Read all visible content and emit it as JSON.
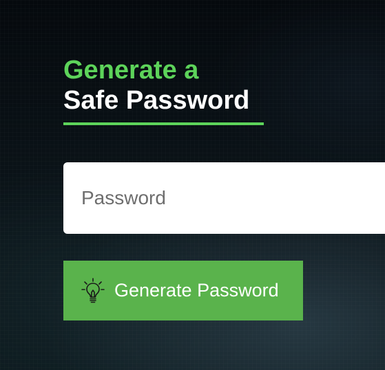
{
  "heading": {
    "line1": "Generate a",
    "line2": "Safe Password"
  },
  "password_input": {
    "placeholder": "Password",
    "value": ""
  },
  "generate_button": {
    "label": "Generate Password",
    "icon": "lightbulb-icon"
  },
  "colors": {
    "accent": "#5dd35a",
    "button": "#5ab34c",
    "heading_white": "#ffffff"
  }
}
